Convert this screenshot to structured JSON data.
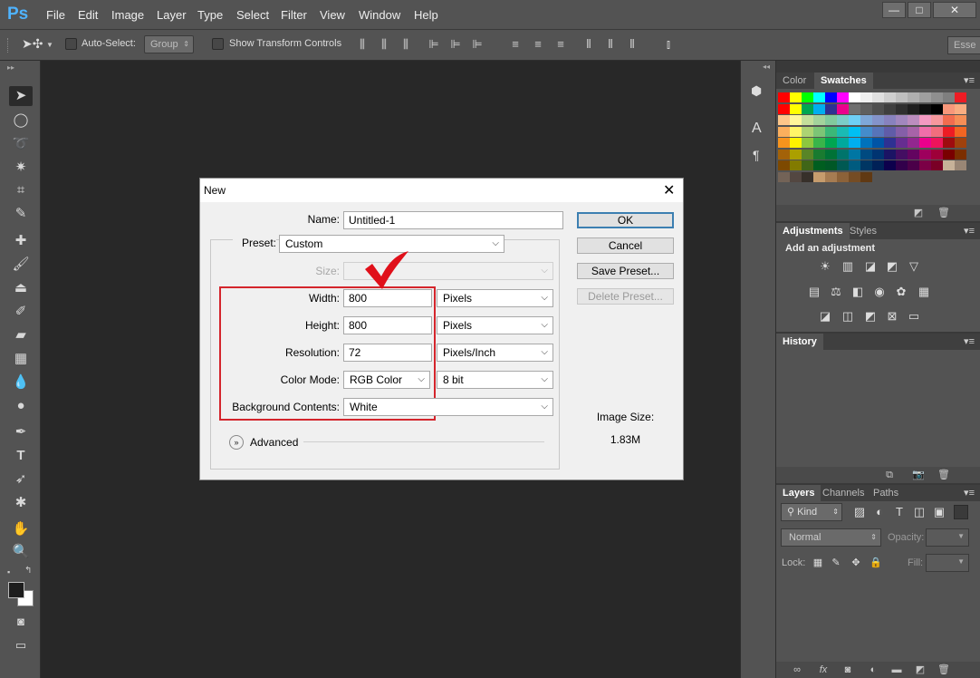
{
  "app": {
    "logo": "Ps"
  },
  "menu": [
    "File",
    "Edit",
    "Image",
    "Layer",
    "Type",
    "Select",
    "Filter",
    "View",
    "Window",
    "Help"
  ],
  "window_controls": {
    "minimize": "—",
    "restore": "□",
    "close": "✕"
  },
  "options_bar": {
    "auto_select_label": "Auto-Select:",
    "auto_select_target": "Group",
    "show_transform_label": "Show Transform Controls",
    "workspace": "Esse"
  },
  "panels": {
    "color_tabs": [
      "Color",
      "Swatches"
    ],
    "adjustments_tabs": [
      "Adjustments",
      "Styles"
    ],
    "adjustments_heading": "Add an adjustment",
    "history_tab": "History",
    "layers_tabs": [
      "Layers",
      "Channels",
      "Paths"
    ],
    "layers_kind": "Kind",
    "blend_mode": "Normal",
    "opacity_label": "Opacity:",
    "lock_label": "Lock:",
    "fill_label": "Fill:"
  },
  "swatches": [
    [
      "#ff0000",
      "#ffff00",
      "#00ff00",
      "#00ffff",
      "#0000ff",
      "#ff00ff",
      "#ffffff",
      "#f0f0f0",
      "#e0e0e0",
      "#cfcfcf",
      "#bfbfbf",
      "#afafaf",
      "#9f9f9f",
      "#8f8f8f",
      "#7f7f7f",
      "#ed1c24"
    ],
    [
      "#ff0000",
      "#ffff00",
      "#00a651",
      "#00aeef",
      "#2e3192",
      "#ec008c",
      "#6f6f6f",
      "#5f5f5f",
      "#4f4f4f",
      "#3f3f3f",
      "#2f2f2f",
      "#1f1f1f",
      "#0f0f0f",
      "#000000",
      "#f7977a",
      "#f9ad81"
    ],
    [
      "#fdc68a",
      "#fff79a",
      "#c4df9b",
      "#a3d39c",
      "#82ca9d",
      "#7bcdc8",
      "#6ecff6",
      "#7ea7d8",
      "#8493ca",
      "#8882be",
      "#a187be",
      "#bc8dbf",
      "#f49ac2",
      "#f6989d",
      "#f26c4f",
      "#f68e56"
    ],
    [
      "#fbaf5d",
      "#fff568",
      "#acd373",
      "#7cc576",
      "#3bb878",
      "#1abbb4",
      "#00bff3",
      "#448ccb",
      "#5674b9",
      "#605ca8",
      "#855fa8",
      "#a763a8",
      "#f06eaa",
      "#f26d7d",
      "#ed1c24",
      "#f26522"
    ],
    [
      "#f7941d",
      "#fff200",
      "#8dc73f",
      "#39b54a",
      "#00a651",
      "#00a99d",
      "#00aeef",
      "#0072bc",
      "#0054a6",
      "#2e3192",
      "#662d91",
      "#92278f",
      "#ec008c",
      "#ed145b",
      "#9e0b0f",
      "#a0410d"
    ],
    [
      "#a36209",
      "#aba000",
      "#598527",
      "#197b30",
      "#007236",
      "#00746b",
      "#0076a3",
      "#004a80",
      "#003471",
      "#1b1464",
      "#440e62",
      "#630460",
      "#9e005d",
      "#9e0039",
      "#790000",
      "#7b2e00"
    ],
    [
      "#7d4900",
      "#827b00",
      "#406618",
      "#005e20",
      "#005826",
      "#005952",
      "#005b7f",
      "#003663",
      "#002157",
      "#0d004c",
      "#32004b",
      "#4b0049",
      "#7b0046",
      "#7a0026",
      "#c7b299",
      "#998675"
    ],
    [
      "#736357",
      "#534741",
      "#37302a",
      "#c69c6d",
      "#a67c52",
      "#8c6239",
      "#754c24",
      "#603913"
    ]
  ],
  "dialog": {
    "title": "New",
    "close": "✕",
    "name_label": "Name:",
    "name_value": "Untitled-1",
    "preset_label": "Preset:",
    "preset_value": "Custom",
    "size_label": "Size:",
    "width_label": "Width:",
    "width_value": "800",
    "width_unit": "Pixels",
    "height_label": "Height:",
    "height_value": "800",
    "height_unit": "Pixels",
    "resolution_label": "Resolution:",
    "resolution_value": "72",
    "resolution_unit": "Pixels/Inch",
    "color_mode_label": "Color Mode:",
    "color_mode_value": "RGB Color",
    "bit_depth": "8 bit",
    "background_label": "Background Contents:",
    "background_value": "White",
    "advanced_label": "Advanced",
    "ok": "OK",
    "cancel": "Cancel",
    "save_preset": "Save Preset...",
    "delete_preset": "Delete Preset...",
    "image_size_label": "Image Size:",
    "image_size_value": "1.83M"
  },
  "colors": {
    "highlight": "#d4252c",
    "checkmark": "#e0101a",
    "ok_border": "#3c7fb1"
  }
}
